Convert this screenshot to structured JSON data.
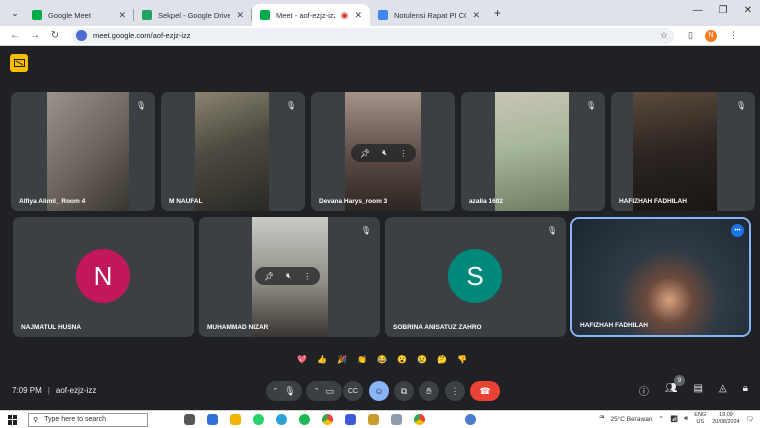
{
  "browser": {
    "tabs": [
      {
        "title": "Google Meet",
        "favicon_color": "#00ac47",
        "active": false
      },
      {
        "title": "Sekpel - Google Drive",
        "favicon_color": "#1fa463",
        "active": false
      },
      {
        "title": "Meet - aof-ezjz-izz",
        "favicon_color": "#00ac47",
        "active": true
      },
      {
        "title": "Notulensi Rapat PI CO Kuliah Ti",
        "favicon_color": "#4285f4",
        "active": false
      }
    ],
    "new_tab": "+",
    "url": "meet.google.com/aof-ezjz-izz",
    "profile_initial": "N"
  },
  "meeting": {
    "time": "7:09 PM",
    "code": "aof-ezjz-izz",
    "participant_badge": "9",
    "participants": [
      {
        "name": "Alfiya Alimil_ Room 4"
      },
      {
        "name": "M NAUFAL"
      },
      {
        "name": "Devana Harys_room 3"
      },
      {
        "name": "azalia 1602"
      },
      {
        "name": "HAFIZHAH FADHILAH"
      },
      {
        "name": "NAJMATUL HUSNA",
        "initial": "N",
        "avatar_color": "#c2185b"
      },
      {
        "name": "MUHAMMAD NIZAR"
      },
      {
        "name": "SOBRINA ANISATUZ ZAHRO",
        "initial": "S",
        "avatar_color": "#00897b"
      },
      {
        "name": "HAFIZHAH FADHILAH"
      }
    ],
    "reactions": [
      "💖",
      "👍",
      "🎉",
      "👏",
      "😂",
      "😮",
      "😢",
      "🤔",
      "👎"
    ],
    "colors": {
      "accent": "#8ab4f8",
      "end_call": "#ea4335",
      "tile_bg": "#3c4043",
      "page_bg": "#202124"
    }
  },
  "taskbar": {
    "search_placeholder": "Type here to search",
    "weather": "25°C Berawan",
    "lang": "ENG",
    "region": "US",
    "time": "19:09",
    "date": "20/08/2024"
  }
}
